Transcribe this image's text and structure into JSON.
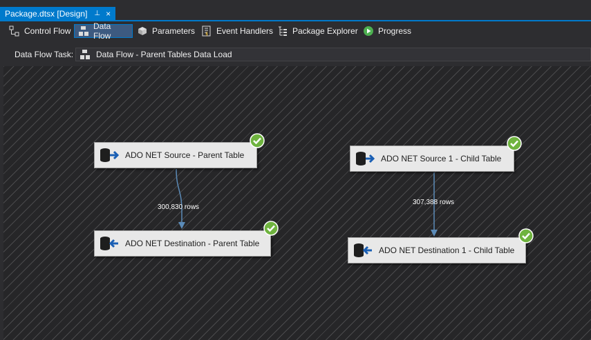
{
  "document_tab": {
    "title": "Package.dtsx [Design]",
    "pin": "⊥",
    "close": "×"
  },
  "designer_tabs": [
    {
      "label": "Control Flow",
      "icon": "control-flow-icon"
    },
    {
      "label": "Data Flow",
      "icon": "data-flow-icon",
      "active": true
    },
    {
      "label": "Parameters",
      "icon": "parameters-icon"
    },
    {
      "label": "Event Handlers",
      "icon": "event-handlers-icon"
    },
    {
      "label": "Package Explorer",
      "icon": "package-explorer-icon"
    },
    {
      "label": "Progress",
      "icon": "progress-icon"
    }
  ],
  "task": {
    "label": "Data Flow Task:",
    "selected": "Data Flow - Parent Tables Data Load"
  },
  "components": {
    "source_parent": {
      "label": "ADO NET Source - Parent Table",
      "status": "success"
    },
    "dest_parent": {
      "label": "ADO NET Destination - Parent Table",
      "status": "success"
    },
    "source_child": {
      "label": "ADO NET Source 1 - Child Table",
      "status": "success"
    },
    "dest_child": {
      "label": "ADO NET Destination 1 - Child Table",
      "status": "success"
    }
  },
  "paths": {
    "parent_rows": "300,830 rows",
    "child_rows": "307,388 rows"
  },
  "colors": {
    "accent": "#007acc",
    "success": "#6fb33f",
    "path": "#5b8bb8"
  }
}
